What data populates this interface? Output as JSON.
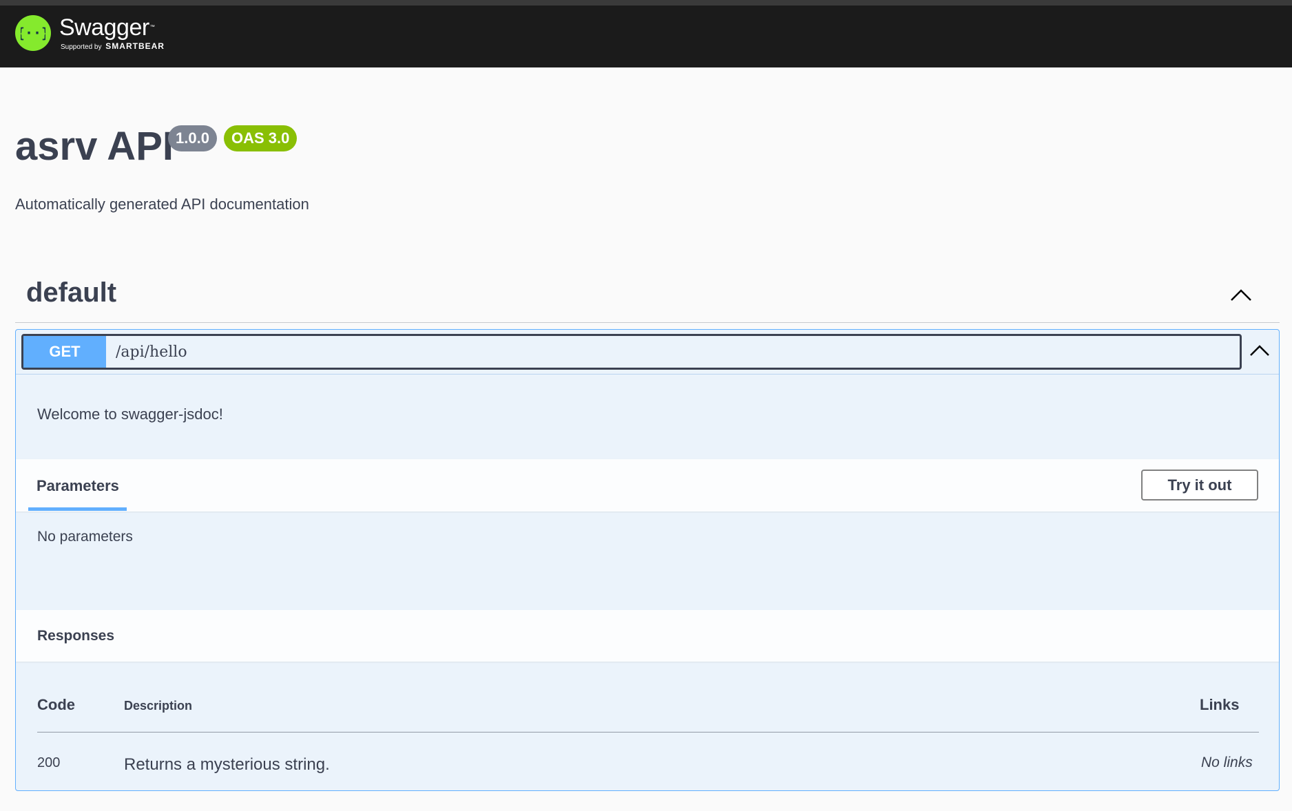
{
  "topbar": {
    "logo_name": "Swagger",
    "logo_tm": "™",
    "logo_supported": "Supported by",
    "logo_brand": "SMARTBEAR"
  },
  "info": {
    "title": "asrv API",
    "version": "1.0.0",
    "oas": "OAS 3.0",
    "description": "Automatically generated API documentation"
  },
  "tag": {
    "name": "default",
    "expanded": true
  },
  "operation": {
    "method": "GET",
    "path": "/api/hello",
    "description": "Welcome to swagger-jsdoc!",
    "parameters_tab": "Parameters",
    "try_button": "Try it out",
    "no_params": "No parameters",
    "responses_title": "Responses",
    "responses_table": {
      "headers": [
        "Code",
        "Description",
        "Links"
      ],
      "rows": [
        {
          "code": "200",
          "description": "Returns a mysterious string.",
          "links": "No links"
        }
      ]
    }
  },
  "colors": {
    "get": "#61affe",
    "oas_badge": "#89bf04",
    "version_badge": "#7d8492",
    "logo_green": "#85ea2d",
    "topbar": "#1b1b1b"
  }
}
